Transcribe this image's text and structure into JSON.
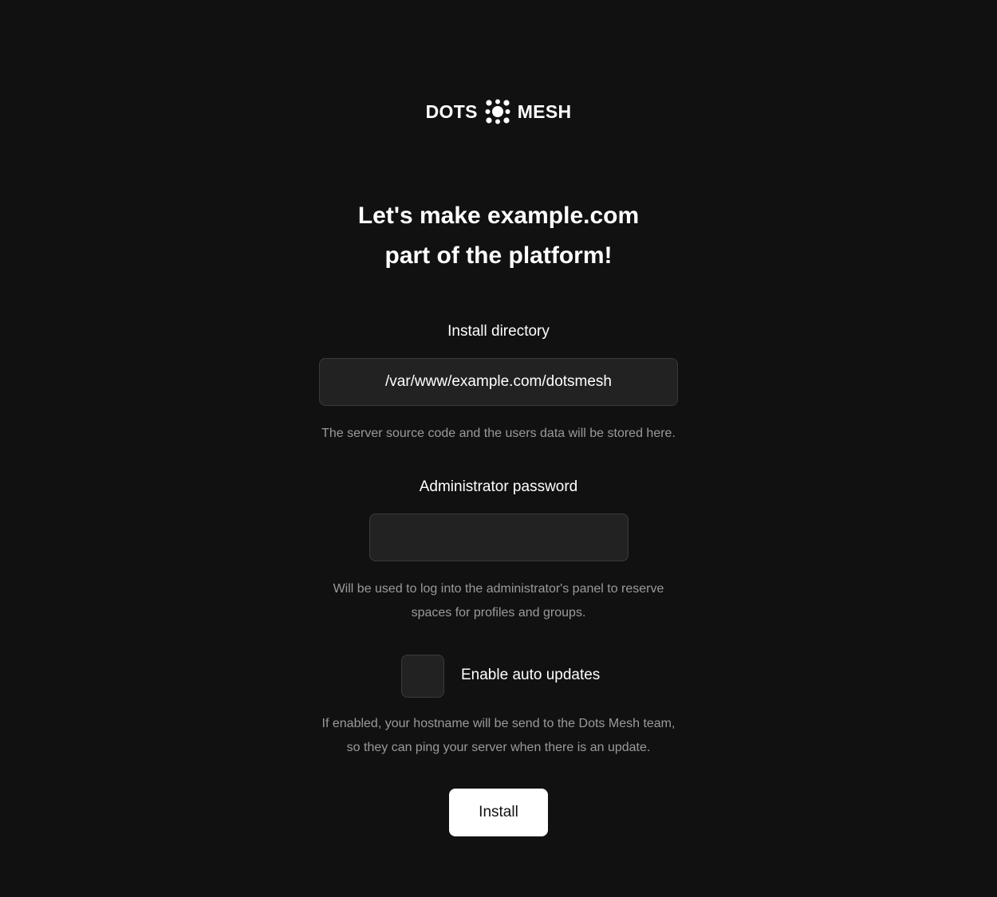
{
  "logo": {
    "left_text": "DOTS",
    "right_text": "MESH",
    "icon": "dots-mesh-logo-icon"
  },
  "title": {
    "line1": "Let's make example.com",
    "line2": "part of the platform!"
  },
  "install_directory": {
    "label": "Install directory",
    "value": "/var/www/example.com/dotsmesh",
    "hint": "The server source code and the users data will be stored here."
  },
  "admin_password": {
    "label": "Administrator password",
    "value": "",
    "hint_line1": "Will be used to log into the administrator's panel to reserve",
    "hint_line2": "spaces for profiles and groups."
  },
  "auto_updates": {
    "label": "Enable auto updates",
    "checked": false,
    "hint_line1": "If enabled, your hostname will be send to the Dots Mesh team,",
    "hint_line2": "so they can ping your server when there is an update."
  },
  "install_button": {
    "label": "Install"
  },
  "colors": {
    "background": "#111111",
    "field_background": "#222222",
    "field_border": "#3a3a3a",
    "hint_text": "#9a9a9a",
    "button_background": "#ffffff",
    "button_text": "#111111"
  }
}
